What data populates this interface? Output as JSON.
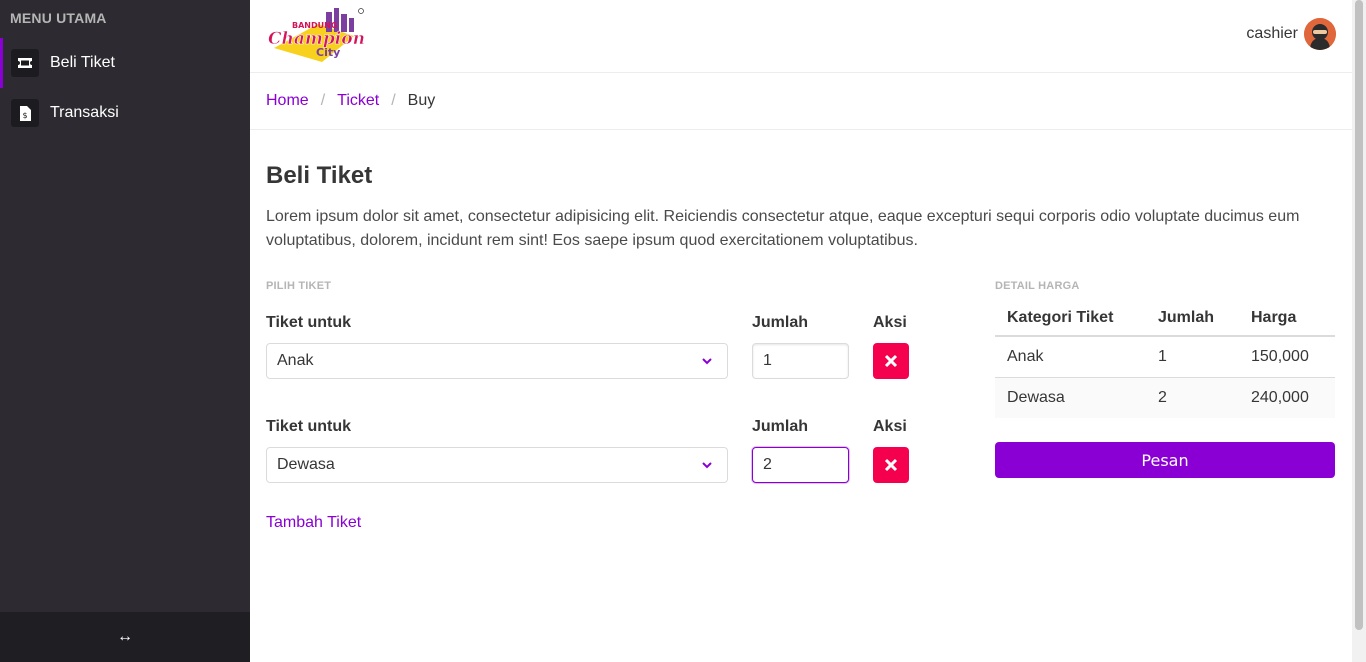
{
  "sidebar": {
    "menu_label": "MENU UTAMA",
    "items": [
      {
        "label": "Beli Tiket",
        "icon": "ticket-icon",
        "active": true
      },
      {
        "label": "Transaksi",
        "icon": "invoice-icon",
        "active": false
      }
    ],
    "footer_icon": "↔"
  },
  "header": {
    "logo_text_1": "BANDUNG",
    "logo_text_2": "Champion",
    "logo_text_3": "City",
    "user": "cashier"
  },
  "breadcrumb": {
    "home": "Home",
    "ticket": "Ticket",
    "current": "Buy",
    "sep": "/"
  },
  "page": {
    "title": "Beli Tiket",
    "description": "Lorem ipsum dolor sit amet, consectetur adipisicing elit. Reiciendis consectetur atque, eaque excepturi sequi corporis odio voluptate ducimus eum voluptatibus, dolorem, incidunt rem sint! Eos saepe ipsum quod exercitationem voluptatibus."
  },
  "form": {
    "section_label": "PILIH TIKET",
    "rows": [
      {
        "ticket_label": "Tiket untuk",
        "qty_label": "Jumlah",
        "action_label": "Aksi",
        "ticket_value": "Anak",
        "qty_value": "1"
      },
      {
        "ticket_label": "Tiket untuk",
        "qty_label": "Jumlah",
        "action_label": "Aksi",
        "ticket_value": "Dewasa",
        "qty_value": "2"
      }
    ],
    "add_label": "Tambah Tiket"
  },
  "price": {
    "section_label": "DETAIL HARGA",
    "headers": [
      "Kategori Tiket",
      "Jumlah",
      "Harga"
    ],
    "rows": [
      [
        "Anak",
        "1",
        "150,000"
      ],
      [
        "Dewasa",
        "2",
        "240,000"
      ]
    ],
    "order_label": "Pesan"
  },
  "colors": {
    "accent": "#8a00d4",
    "danger": "#f5004f",
    "sidebar": "#2d2b31"
  }
}
